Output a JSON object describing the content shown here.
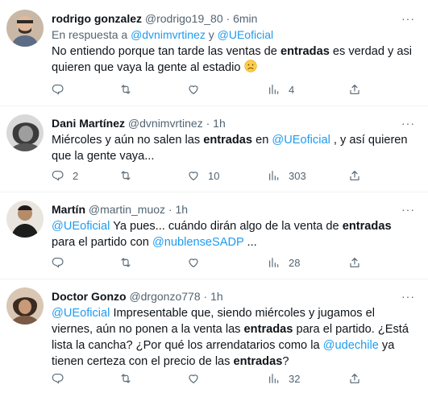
{
  "tweets": [
    {
      "name": "rodrigo gonzalez",
      "handle": "@rodrigo19_80",
      "sep": "·",
      "time": "6min",
      "more": "···",
      "reply_prefix": "En respuesta a",
      "reply_to_1": "@dvnimvrtinez",
      "reply_and": "y",
      "reply_to_2": "@UEoficial",
      "text_1": "No entiendo porque tan tarde las ventas de",
      "text_bold_1": "entradas",
      "text_2": "es verdad y asi quieren que vaya la gente al estadio",
      "emoji": "slightly-frowning-face",
      "replies": "",
      "retweets": "",
      "likes": "",
      "views": "4"
    },
    {
      "name": "Dani Martínez",
      "handle": "@dvnimvrtinez",
      "sep": "·",
      "time": "1h",
      "more": "···",
      "text_1": "Miércoles y aún no salen las",
      "text_bold_1": "entradas",
      "text_2": "en",
      "mention_1": "@UEoficial",
      "text_3": ", y así quieren que la gente vaya...",
      "replies": "2",
      "retweets": "",
      "likes": "10",
      "views": "303"
    },
    {
      "name": "Martín",
      "handle": "@martin_muoz",
      "sep": "·",
      "time": "1h",
      "more": "···",
      "mention_1": "@UEoficial",
      "text_1": "Ya pues... cuándo dirán algo de la venta de",
      "text_bold_1": "entradas",
      "text_2": "para el partido con",
      "mention_2": "@nublenseSADP",
      "text_3": "...",
      "replies": "",
      "retweets": "",
      "likes": "",
      "views": "28"
    },
    {
      "name": "Doctor Gonzo",
      "handle": "@drgonzo778",
      "sep": "·",
      "time": "1h",
      "more": "···",
      "mention_1": "@UEoficial",
      "text_1": "Impresentable que, siendo miércoles y jugamos el viernes, aún no ponen a la venta las",
      "text_bold_1": "entradas",
      "text_2": "para el partido. ¿Está lista la cancha? ¿Por qué los arrendatarios como la",
      "mention_2": "@udechile",
      "text_3": "ya tienen certeza con el precio de las",
      "text_bold_2": "entradas",
      "text_4": "?",
      "replies": "",
      "retweets": "",
      "likes": "",
      "views": "32"
    }
  ],
  "icons": {
    "reply": "reply-icon",
    "retweet": "retweet-icon",
    "like": "like-icon",
    "views": "views-icon",
    "share": "share-icon"
  },
  "colors": {
    "link": "#1d9bf0",
    "muted": "#536471",
    "text": "#0f1419",
    "divider": "#eff3f4"
  }
}
